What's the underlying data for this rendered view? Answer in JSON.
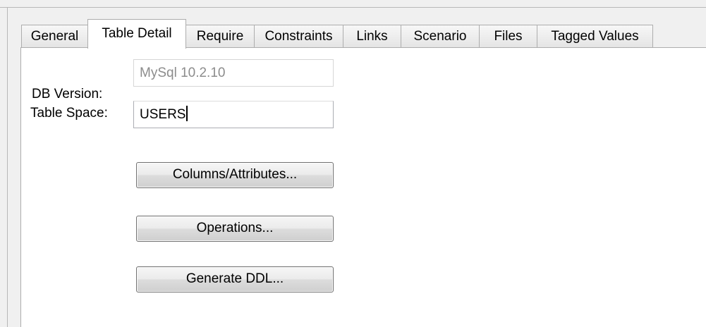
{
  "tabs": [
    {
      "label": "General",
      "selected": false
    },
    {
      "label": "Table Detail",
      "selected": true
    },
    {
      "label": "Require",
      "selected": false
    },
    {
      "label": "Constraints",
      "selected": false
    },
    {
      "label": "Links",
      "selected": false
    },
    {
      "label": "Scenario",
      "selected": false
    },
    {
      "label": "Files",
      "selected": false
    },
    {
      "label": "Tagged Values",
      "selected": false
    }
  ],
  "form": {
    "db_version_label": "DB Version:",
    "db_version_value": "MySql 10.2.10",
    "table_space_label": "Table Space:",
    "table_space_value": "USERS"
  },
  "buttons": {
    "columns_attributes": "Columns/Attributes...",
    "operations": "Operations...",
    "generate_ddl": "Generate DDL..."
  }
}
